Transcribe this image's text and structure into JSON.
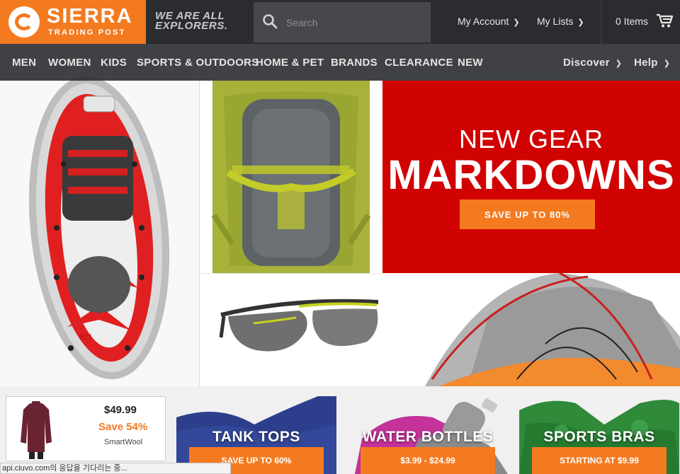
{
  "header": {
    "logo_name": "SIERRA",
    "logo_sub": "TRADING POST",
    "tagline": "WE ARE ALL EXPLORERS.",
    "search_placeholder": "Search",
    "my_account": "My Account",
    "my_lists": "My Lists",
    "cart_label": "0 Items"
  },
  "nav": {
    "items": [
      "MEN",
      "WOMEN",
      "KIDS",
      "SPORTS & OUTDOORS",
      "HOME & PET",
      "BRANDS",
      "CLEARANCE",
      "NEW"
    ],
    "discover": "Discover",
    "help": "Help"
  },
  "promo": {
    "line1": "NEW GEAR",
    "line2": "MARKDOWNS",
    "button": "SAVE UP TO 80%"
  },
  "product": {
    "price": "$49.99",
    "save": "Save 54%",
    "brand": "SmartWool"
  },
  "categories": [
    {
      "title": "TANK TOPS",
      "button": "SAVE UP TO 60%"
    },
    {
      "title": "WATER BOTTLES",
      "button": "$3.99 - $24.99"
    },
    {
      "title": "SPORTS BRAS",
      "button": "STARTING AT $9.99"
    }
  ],
  "status_bar": "api.ciuvo.com의 응답을 기다리는 중...",
  "colors": {
    "brand_orange": "#f47a20",
    "promo_red": "#d10202",
    "header_dark": "#2b2c30"
  }
}
